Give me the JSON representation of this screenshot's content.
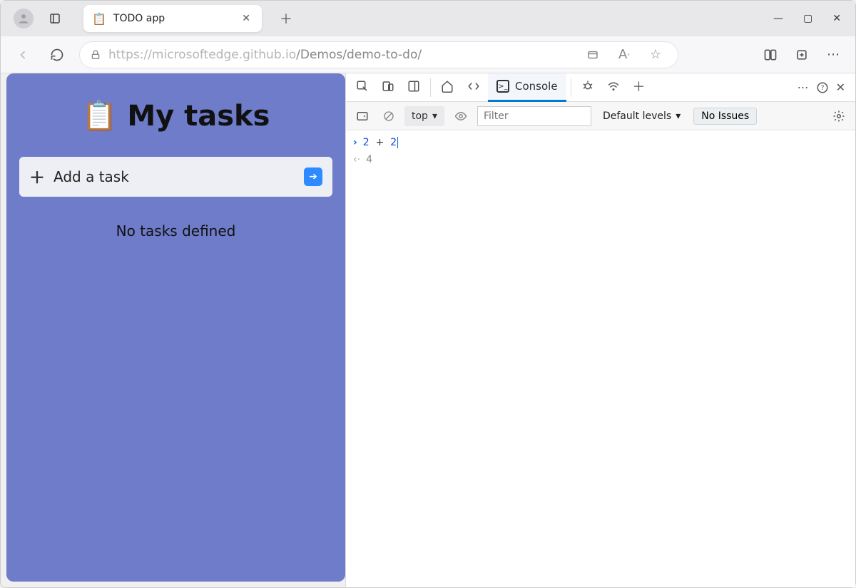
{
  "browser": {
    "tab_title": "TODO app",
    "url_host": "https://microsoftedge.github.io",
    "url_path": "/Demos/demo-to-do/"
  },
  "page": {
    "heading": "My tasks",
    "add_placeholder": "Add a task",
    "empty_msg": "No tasks defined"
  },
  "devtools": {
    "tabs": {
      "console": "Console"
    },
    "toolbar": {
      "context": "top",
      "filter_placeholder": "Filter",
      "levels": "Default levels",
      "issues": "No Issues"
    },
    "console": {
      "input": "2 + 2",
      "input_tok1": "2",
      "input_op": "+",
      "input_tok2": "2",
      "result": "4"
    }
  }
}
